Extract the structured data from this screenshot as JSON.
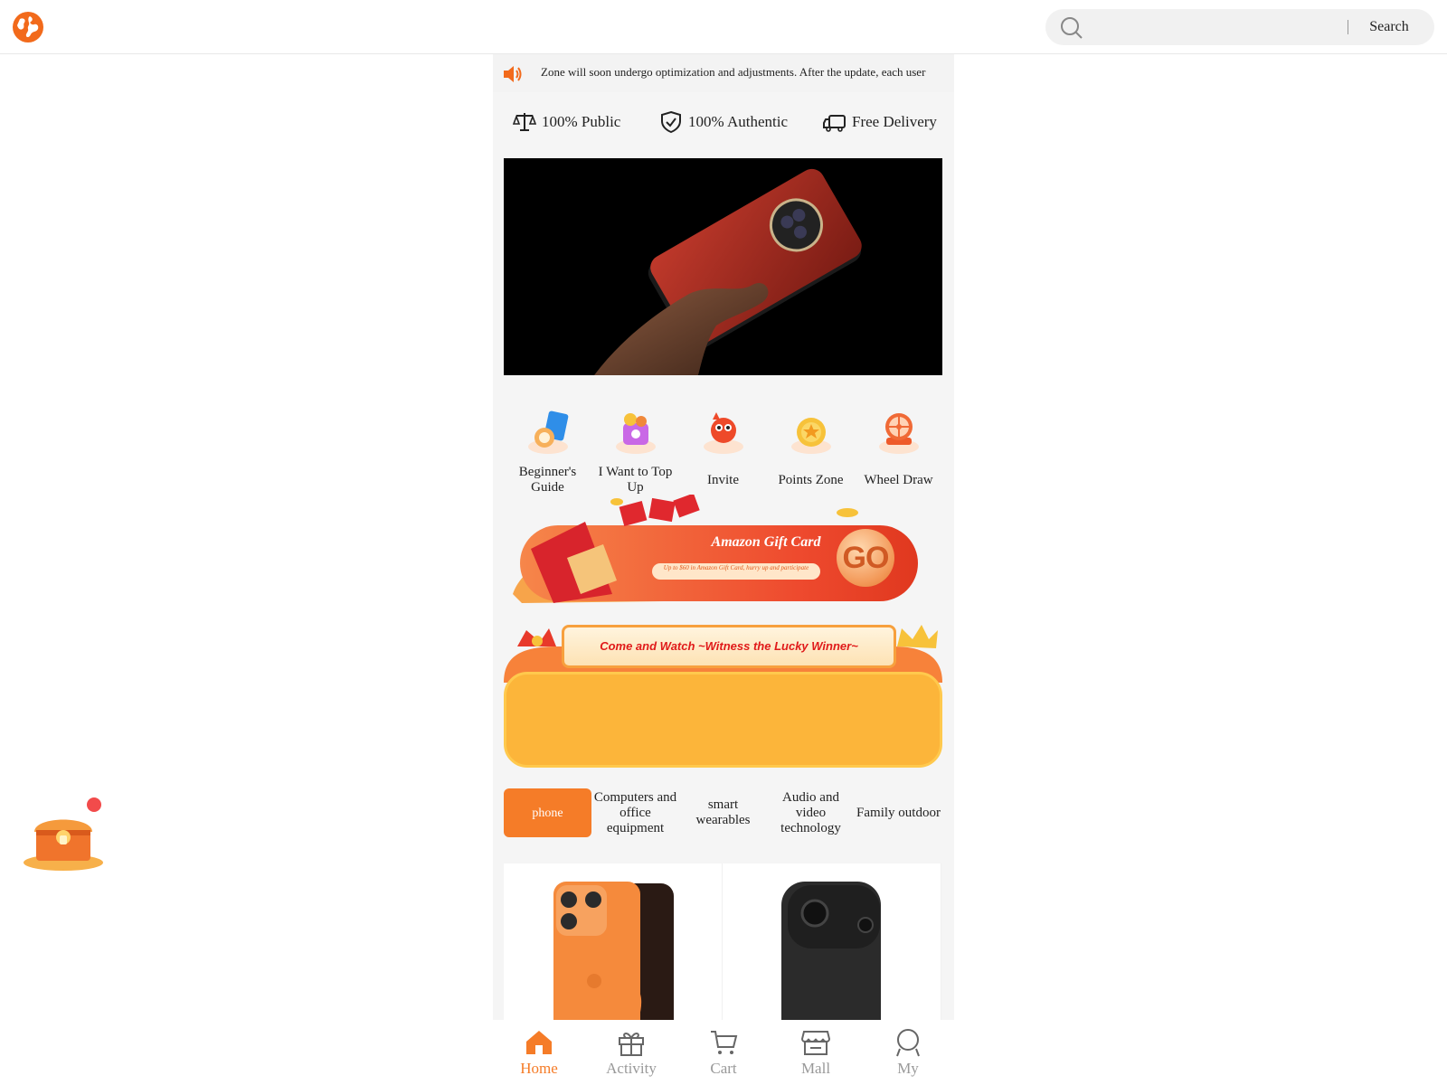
{
  "header": {
    "logo_icon": "globe-icon",
    "search": {
      "placeholder": "",
      "button_label": "Search"
    }
  },
  "notice": {
    "icon": "speaker-icon",
    "text": "Zone will soon undergo optimization and adjustments. After the update, each user"
  },
  "features": [
    {
      "icon": "scale-icon",
      "label": "100% Public"
    },
    {
      "icon": "shield-check-icon",
      "label": "100% Authentic"
    },
    {
      "icon": "truck-icon",
      "label": "Free Delivery"
    }
  ],
  "quick_links": [
    {
      "icon": "guide-book-icon",
      "label": "Beginner's Guide"
    },
    {
      "icon": "top-up-icon",
      "label": "I Want to Top Up"
    },
    {
      "icon": "invite-icon",
      "label": "Invite"
    },
    {
      "icon": "points-coin-icon",
      "label": "Points Zone"
    },
    {
      "icon": "wheel-icon",
      "label": "Wheel Draw"
    }
  ],
  "gift_banner": {
    "title": "Amazon Gift Card",
    "subtitle": "Up to $60 in Amazon Gift Card, hurry up and participate",
    "go_label": "GO"
  },
  "winner_panel": {
    "title": "Come and Watch ~Witness the Lucky Winner~"
  },
  "categories": [
    {
      "label": "phone",
      "active": true
    },
    {
      "label": "Computers and office equipment",
      "active": false
    },
    {
      "label": "smart wearables",
      "active": false
    },
    {
      "label": "Audio and video technology",
      "active": false
    },
    {
      "label": "Family outdoor",
      "active": false
    }
  ],
  "tabbar": [
    {
      "icon": "home-icon",
      "label": "Home",
      "active": true
    },
    {
      "icon": "gift-icon",
      "label": "Activity",
      "active": false
    },
    {
      "icon": "cart-icon",
      "label": "Cart",
      "active": false
    },
    {
      "icon": "store-icon",
      "label": "Mall",
      "active": false
    },
    {
      "icon": "user-icon",
      "label": "My",
      "active": false
    }
  ],
  "colors": {
    "accent": "#f57c28",
    "winner_bg": "#fcb53a",
    "badge_red": "#f24b4b"
  }
}
